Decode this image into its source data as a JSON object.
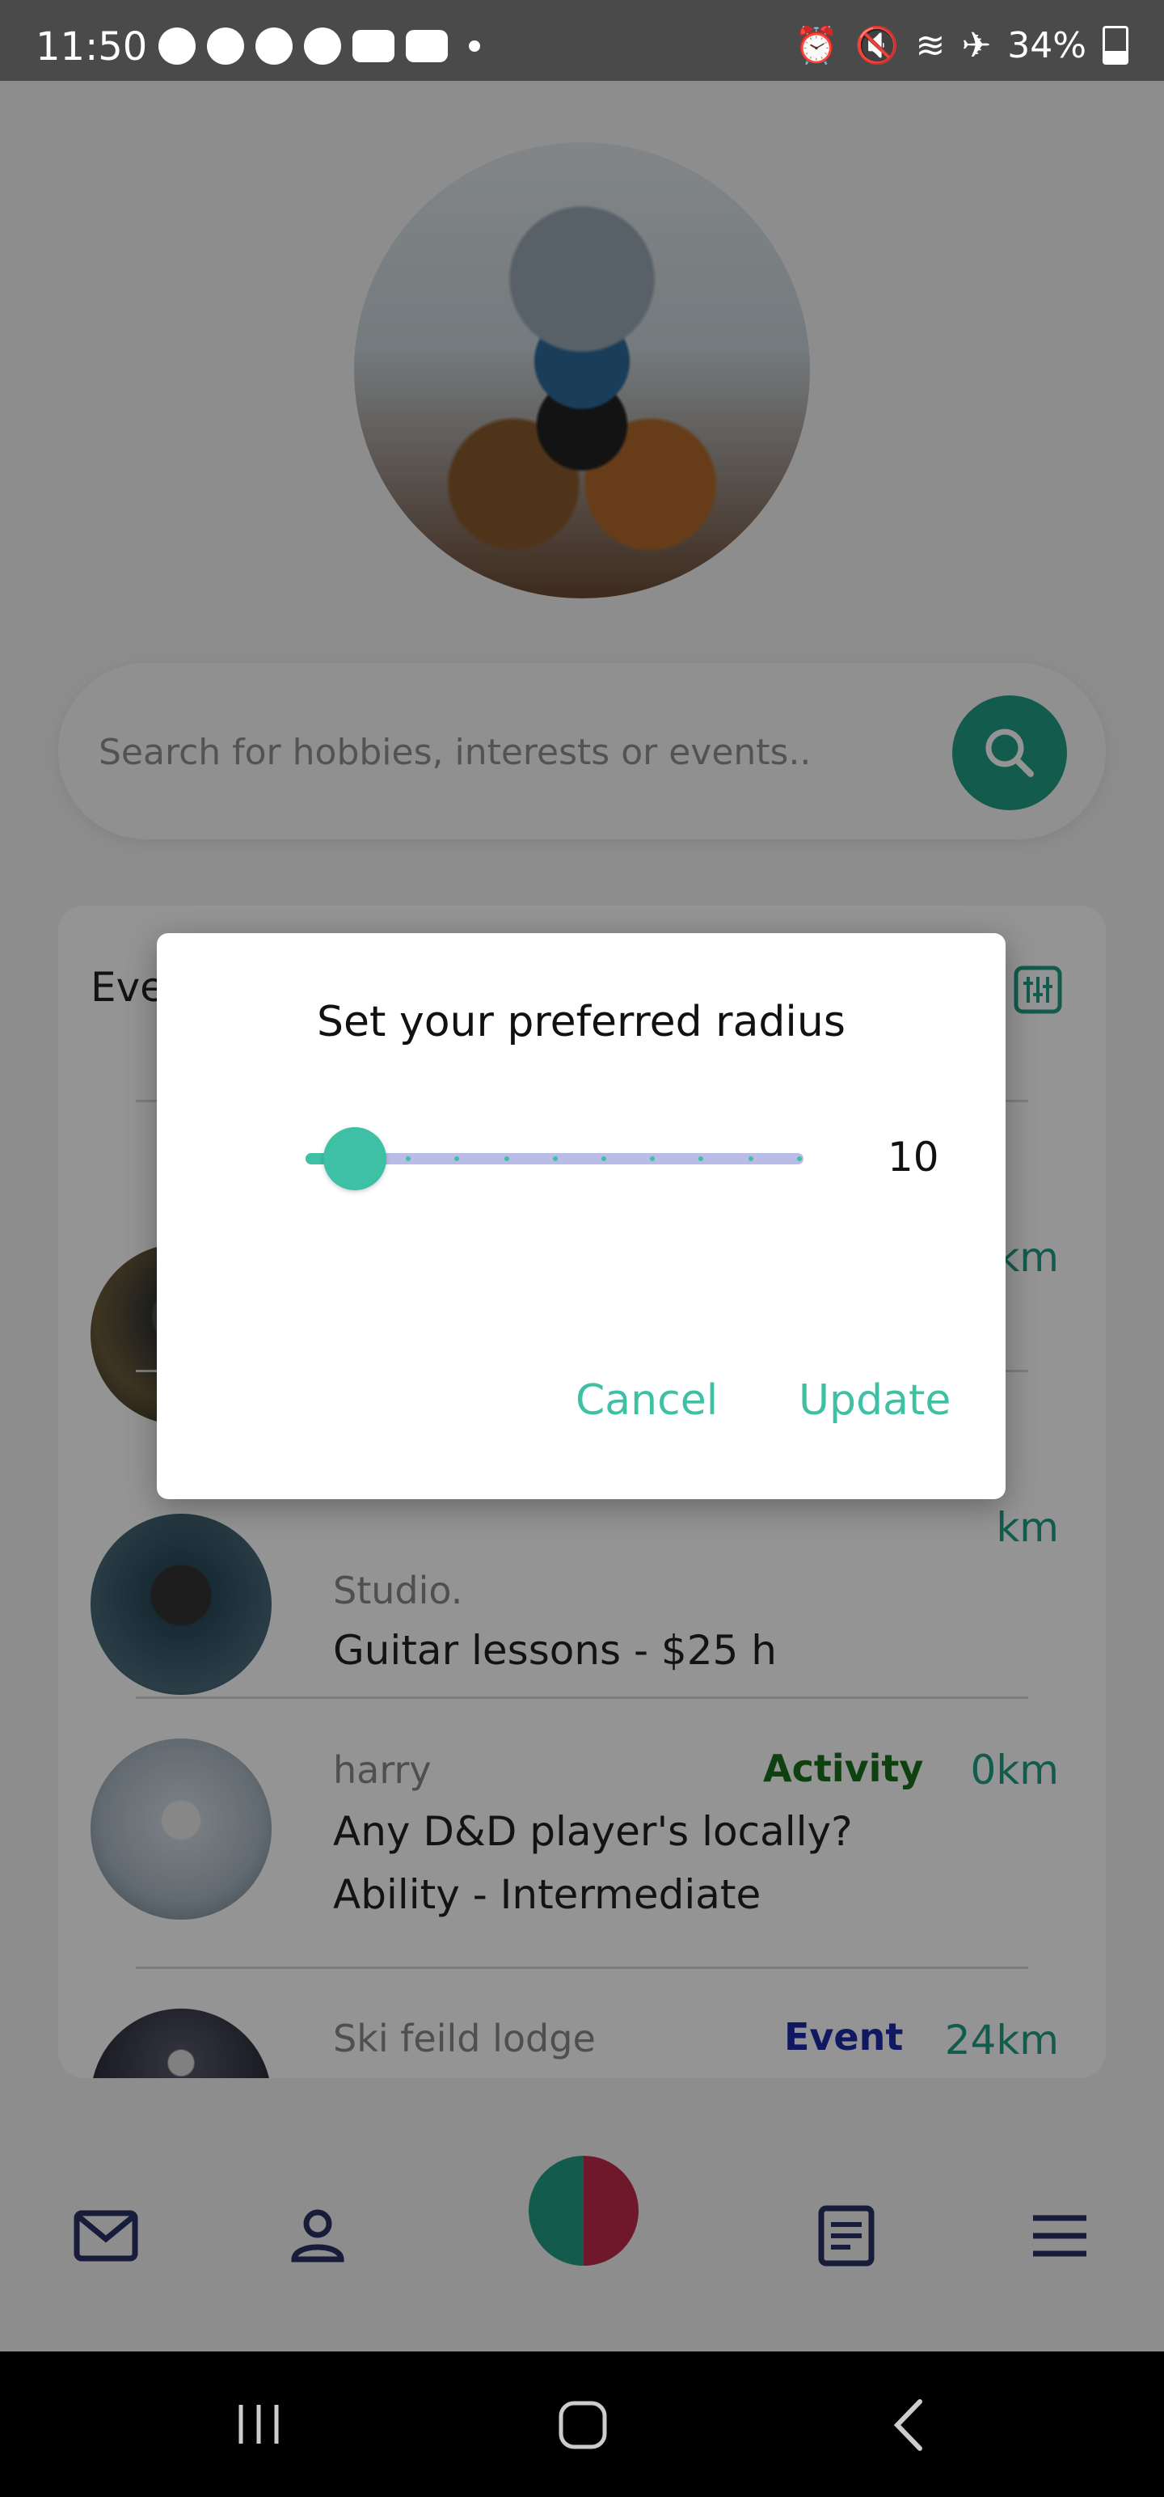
{
  "status_bar": {
    "time": "11:50",
    "battery": "34%",
    "left_icons": [
      "snapchat-icon",
      "messenger-icon",
      "chrome-icon",
      "facebook-icon",
      "youtube-icon",
      "youtube-icon"
    ],
    "right_icons": [
      "alarm-icon",
      "mute-icon",
      "wifi-icon",
      "airplane-icon",
      "battery-icon"
    ]
  },
  "search": {
    "placeholder": "Search for hobbies, interests or events.."
  },
  "events": {
    "title": "Eve",
    "rows": [
      {
        "user": "",
        "type": "",
        "type_color": "#1a6e1a",
        "distance": "km",
        "line1": "",
        "line2": ""
      },
      {
        "user": "",
        "type": "",
        "type_color": "#1a6e1a",
        "distance": "km",
        "line1": "Studio.",
        "line2": "Guitar lessons - $25 h"
      },
      {
        "user": "harry",
        "type": "Activity",
        "type_color": "#1a6e1a",
        "distance": "0km",
        "line1": "Any D&D player's locally?",
        "line2": "Ability - Intermediate"
      },
      {
        "user": "Ski feild lodge",
        "type": "Event",
        "type_color": "#1a2aa8",
        "distance": "24km",
        "line1": "",
        "line2": ""
      }
    ]
  },
  "dialog": {
    "title": "Set your preferred radius",
    "slider_value": "10",
    "slider_fraction": 0.0,
    "cancel_label": "Cancel",
    "update_label": "Update"
  },
  "colors": {
    "accent": "#3ec0a4",
    "search_button": "#1f9e86",
    "track": "#b8bce6"
  },
  "bottom_nav": [
    "mail-icon",
    "profile-icon",
    "center-action-button",
    "notes-icon",
    "menu-icon"
  ]
}
